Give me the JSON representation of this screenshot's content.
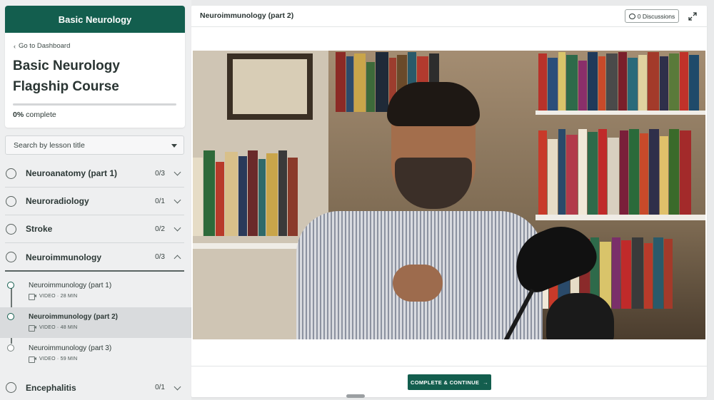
{
  "course": {
    "school_name": "Basic Neurology",
    "dashboard_link": "Go to Dashboard",
    "title": "Basic Neurology Flagship Course",
    "progress_percent": "0%",
    "progress_fraction": 0,
    "progress_suffix": "complete"
  },
  "search": {
    "placeholder": "Search by lesson title"
  },
  "sections": [
    {
      "label": "Neuroanatomy (part 1)",
      "count": "0/3",
      "expanded": false
    },
    {
      "label": "Neuroradiology",
      "count": "0/1",
      "expanded": false
    },
    {
      "label": "Stroke",
      "count": "0/2",
      "expanded": false
    },
    {
      "label": "Neuroimmunology",
      "count": "0/3",
      "expanded": true
    },
    {
      "label": "Encephalitis",
      "count": "0/1",
      "expanded": false
    }
  ],
  "lessons": [
    {
      "title": "Neuroimmunology (part 1)",
      "meta": "VIDEO · 28 MIN",
      "active": false
    },
    {
      "title": "Neuroimmunology (part 2)",
      "meta": "VIDEO · 48 MIN",
      "active": true
    },
    {
      "title": "Neuroimmunology (part 3)",
      "meta": "VIDEO · 59 MIN",
      "active": false
    }
  ],
  "main": {
    "lesson_title": "Neuroimmunology (part 2)",
    "discussions_label": "0 Discussions",
    "complete_button": "COMPLETE & CONTINUE",
    "complete_arrow": "→"
  },
  "icons": {
    "back": "chevron-left-icon",
    "dropdown": "caret-down-icon",
    "discussion": "speech-bubble-icon",
    "fullscreen": "expand-icon",
    "video": "video-camera-icon"
  },
  "colors": {
    "brand": "#135e4e",
    "sidebar_bg": "#eeeff0",
    "active_row": "#d9dbdd"
  }
}
